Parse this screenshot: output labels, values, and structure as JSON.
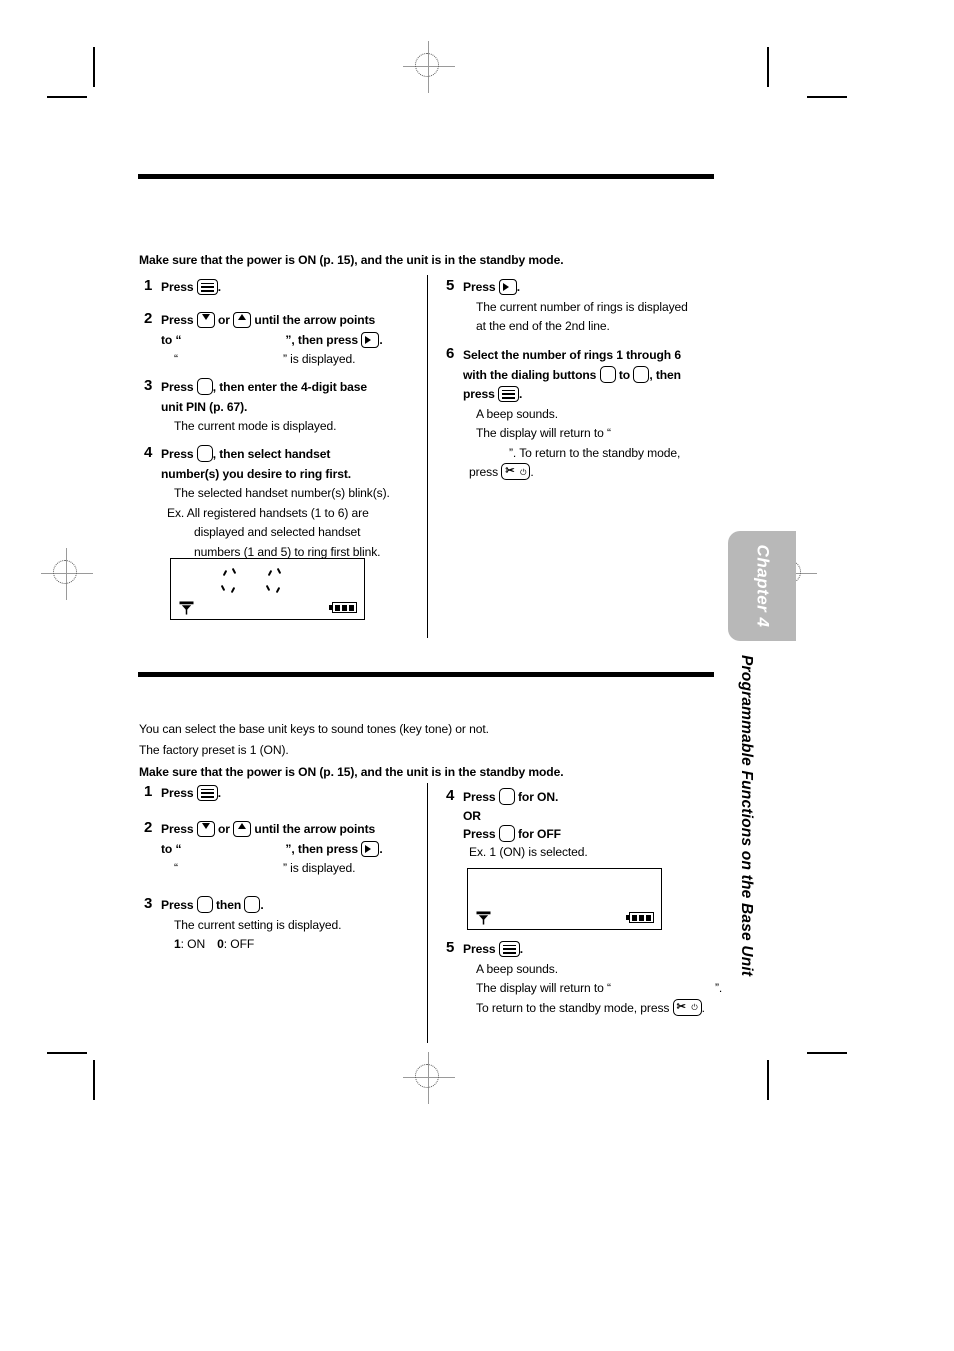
{
  "document": {
    "chapter_tab": "Chapter 4",
    "side_title": "Programmable Functions on the Base Unit"
  },
  "section_ring": {
    "precondition": "Make sure that the power is ON (p. 15), and the unit is in the standby mode.",
    "steps_left": [
      {
        "num": "1",
        "body_pre": "Press ",
        "body_post": "."
      },
      {
        "num": "2",
        "line1_a": "Press ",
        "line1_b": " or ",
        "line1_c": " until the arrow points",
        "line2_a": "to “",
        "line2_b": "”, then press ",
        "line2_c": ".",
        "line3_a": "“",
        "line3_b": "” is displayed."
      },
      {
        "num": "3",
        "line1_a": "Press ",
        "line1_b": ", then enter the 4-digit base",
        "line2": "unit PIN (p. 67).",
        "note": "The current mode is displayed."
      },
      {
        "num": "4",
        "line1_a": "Press ",
        "line1_b": ", then select handset",
        "line2": "number(s) you desire to ring first.",
        "note1": "The selected handset number(s) blink(s).",
        "note2": "Ex. All registered handsets (1 to 6) are",
        "note3": "displayed and selected handset",
        "note4": "numbers (1 and 5) to ring first blink."
      }
    ],
    "steps_right": [
      {
        "num": "5",
        "body_pre": "Press ",
        "body_post": ".",
        "note1": "The current number of rings is displayed",
        "note2": "at the end of the 2nd line."
      },
      {
        "num": "6",
        "line1": "Select the number of rings 1 through 6",
        "line2_a": "with the dialing buttons ",
        "line2_b": " to ",
        "line2_c": ", then",
        "line3_a": "press ",
        "line3_b": ".",
        "note1": "A beep sounds.",
        "note2": "The display will return to “",
        "note3": "”. To return to the standby mode,",
        "note4_a": "press ",
        "note4_b": "."
      }
    ]
  },
  "section_keytone": {
    "intro1": "You can select the base unit keys to sound tones (key tone) or not.",
    "intro2": "The factory preset is 1 (ON).",
    "precondition": "Make sure that the power is ON (p. 15), and the unit is in the standby mode.",
    "steps_left": [
      {
        "num": "1",
        "body_pre": "Press ",
        "body_post": "."
      },
      {
        "num": "2",
        "line1_a": "Press ",
        "line1_b": " or ",
        "line1_c": " until the arrow points",
        "line2_a": "to “",
        "line2_b": "”, then press ",
        "line2_c": ".",
        "line3_a": "“",
        "line3_b": "” is displayed."
      },
      {
        "num": "3",
        "line1_a": "Press ",
        "line1_b": " then ",
        "line1_c": ".",
        "note1": "The current setting is displayed.",
        "note2_a": "1",
        "note2_b": ": ON",
        "note2_c": "0",
        "note2_d": ": OFF"
      }
    ],
    "steps_right": [
      {
        "num": "4",
        "line1_a": "Press ",
        "line1_b": " for ON.",
        "line2": "OR",
        "line3_a": "Press ",
        "line3_b": " for OFF",
        "note": "Ex. 1 (ON) is selected."
      },
      {
        "num": "5",
        "body_pre": "Press ",
        "body_post": ".",
        "note1": "A beep sounds.",
        "note2_a": "The display will return to “",
        "note2_b": "”.",
        "note3_a": "To return to the standby mode, press ",
        "note3_b": "."
      }
    ]
  },
  "icons": {
    "menu": "menu-key-icon",
    "arrow_down": "arrow-down-key-icon",
    "arrow_up": "arrow-up-key-icon",
    "arrow_right": "arrow-right-key-icon",
    "blank_key": "blank-dial-key-icon",
    "off_key": "off-power-key-icon",
    "antenna": "antenna-icon",
    "battery": "battery-full-icon"
  },
  "colors": {
    "ink": "#000000",
    "tab_gray": "#b8b8b8",
    "reg_mark": "#9a9a9a"
  }
}
